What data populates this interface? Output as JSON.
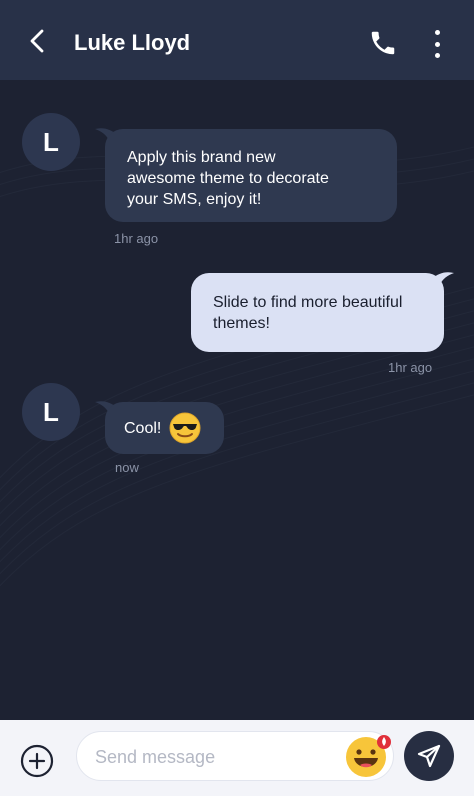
{
  "header": {
    "contact_name": "Luke Lloyd",
    "back_icon": "chevron-left-icon",
    "call_icon": "phone-icon",
    "more_icon": "more-vertical-icon"
  },
  "messages": [
    {
      "direction": "incoming",
      "avatar_initial": "L",
      "lines": [
        "Apply this brand new",
        "awesome theme to decorate",
        "your SMS, enjoy it!"
      ],
      "time": "1hr ago"
    },
    {
      "direction": "outgoing",
      "lines": [
        "Slide to find more beautiful",
        "themes!"
      ],
      "time": "1hr ago"
    },
    {
      "direction": "incoming",
      "avatar_initial": "L",
      "text": "Cool!",
      "emoji": "sunglasses-emoji",
      "time": "now"
    }
  ],
  "composer": {
    "placeholder": "Send message",
    "value": "",
    "add_icon": "plus-circle-icon",
    "emoji_icon": "grinning-emoji-icon",
    "send_icon": "paper-plane-icon"
  },
  "colors": {
    "background": "#1d2232",
    "header": "#283148",
    "incoming_bubble": "#2f3950",
    "outgoing_bubble": "#dbe1f4",
    "composer": "#f3f4f9",
    "send_button": "#272e42"
  }
}
